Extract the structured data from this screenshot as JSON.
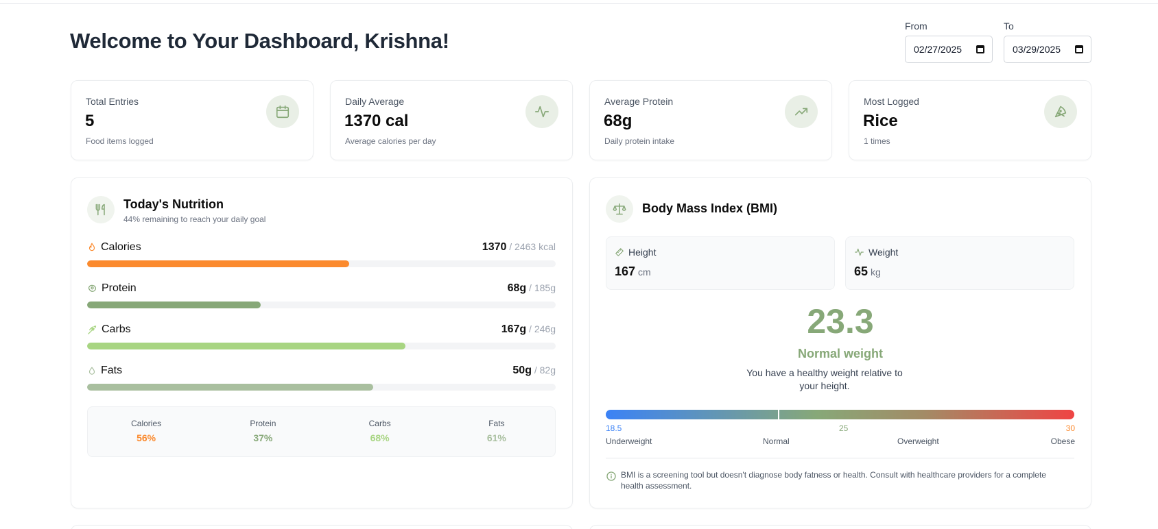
{
  "header": {
    "title": "Welcome to Your Dashboard, Krishna!",
    "from_label": "From",
    "from_value": "02/27/2025",
    "to_label": "To",
    "to_value": "03/29/2025"
  },
  "stats": [
    {
      "label": "Total Entries",
      "value": "5",
      "sub": "Food items logged",
      "icon": "calendar-icon"
    },
    {
      "label": "Daily Average",
      "value": "1370 cal",
      "sub": "Average calories per day",
      "icon": "activity-icon"
    },
    {
      "label": "Average Protein",
      "value": "68g",
      "sub": "Daily protein intake",
      "icon": "trending-up-icon"
    },
    {
      "label": "Most Logged",
      "value": "Rice",
      "sub": "1 times",
      "icon": "pizza-icon"
    }
  ],
  "nutrition": {
    "title": "Today's Nutrition",
    "subtitle": "44% remaining to reach your daily goal",
    "rows": [
      {
        "name": "Calories",
        "amount": "1370",
        "total": " / 2463 kcal",
        "progress": 0.56,
        "color": "#fb8a2e",
        "icon": "flame-icon"
      },
      {
        "name": "Protein",
        "amount": "68g",
        "total": " / 185g",
        "progress": 0.37,
        "color": "#87a878",
        "icon": "beef-icon"
      },
      {
        "name": "Carbs",
        "amount": "167g",
        "total": " / 246g",
        "progress": 0.68,
        "color": "#a8d582",
        "icon": "wheat-icon"
      },
      {
        "name": "Fats",
        "amount": "50g",
        "total": " / 82g",
        "progress": 0.61,
        "color": "#a9bf9f",
        "icon": "droplet-icon"
      }
    ],
    "summary": [
      {
        "label": "Calories",
        "value": "56%",
        "color": "#fb8a2e"
      },
      {
        "label": "Protein",
        "value": "37%",
        "color": "#87a878"
      },
      {
        "label": "Carbs",
        "value": "68%",
        "color": "#a8d582"
      },
      {
        "label": "Fats",
        "value": "61%",
        "color": "#a9bf9f"
      }
    ]
  },
  "bmi": {
    "title": "Body Mass Index (BMI)",
    "height_label": "Height",
    "height_value": "167",
    "height_unit": "cm",
    "weight_label": "Weight",
    "weight_value": "65",
    "weight_unit": "kg",
    "value": "23.3",
    "category": "Normal weight",
    "description": "You have a healthy weight relative to your height.",
    "ticks": {
      "low": "18.5",
      "mid": "25",
      "high": "30"
    },
    "ranges": {
      "underweight": "Underweight",
      "normal": "Normal",
      "overweight": "Overweight",
      "obese": "Obese"
    },
    "note": "BMI is a screening tool but doesn't diagnose body fatness or health. Consult with healthcare providers for a complete health assessment."
  },
  "colors": {
    "accent": "#87a878",
    "calories": "#fb8a2e",
    "underweight": "#3b82f6",
    "obese": "#ef4444"
  }
}
